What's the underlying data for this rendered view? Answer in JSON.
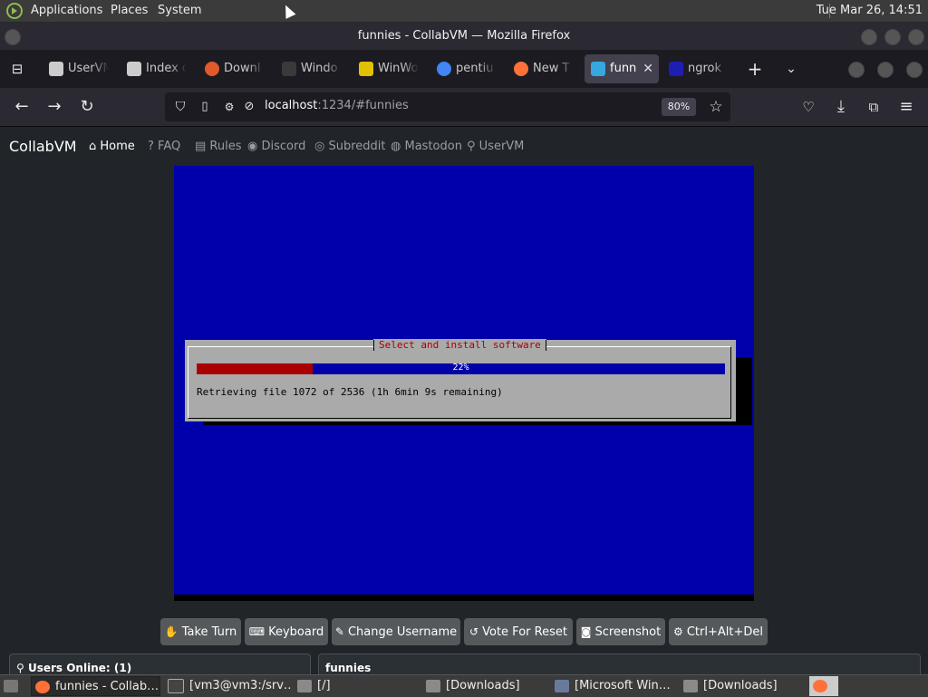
{
  "top_panel": {
    "menus": [
      "Applications",
      "Places",
      "System"
    ],
    "clock": "Tue Mar 26, 14:51"
  },
  "window": {
    "title": "funnies - CollabVM — Mozilla Firefox"
  },
  "tabs": [
    {
      "label": "UserVM",
      "icon": "uservm-icon",
      "color": "#cccccc"
    },
    {
      "label": "Index o",
      "icon": "uservm-icon",
      "color": "#cccccc"
    },
    {
      "label": "Downl",
      "icon": "debian-icon",
      "color": "#e05a2a"
    },
    {
      "label": "Windo",
      "icon": "winworld-icon",
      "color": "#3a3a3a"
    },
    {
      "label": "WinWo",
      "icon": "winworld-w-icon",
      "color": "#e2c100"
    },
    {
      "label": "pentiu",
      "icon": "google-icon",
      "color": "#4285f4"
    },
    {
      "label": "New T",
      "icon": "firefox-icon",
      "color": "#ff7139"
    },
    {
      "label": "funn",
      "icon": "monitor-icon",
      "color": "#37a7e0"
    },
    {
      "label": "ngrok",
      "icon": "ngrok-icon",
      "color": "#1f1eb3"
    }
  ],
  "navbar": {
    "url_host": "localhost",
    "url_rest": ":1234/#funnies",
    "zoom": "80%"
  },
  "site": {
    "brand": "CollabVM",
    "nav": [
      "Home",
      "FAQ",
      "Rules",
      "Discord",
      "Subreddit",
      "Mastodon",
      "UserVM"
    ]
  },
  "vm": {
    "dialog_title": "Select and install software",
    "progress_percent": 22,
    "progress_label": "22%",
    "status": "Retrieving file 1072 of 2536 (1h 6min 9s remaining)"
  },
  "controls": [
    "Take Turn",
    "Keyboard",
    "Change Username",
    "Vote For Reset",
    "Screenshot",
    "Ctrl+Alt+Del"
  ],
  "panels": {
    "users": "Users Online: (1)",
    "chat": "funnies"
  },
  "taskbar": [
    {
      "label": "funnies - Collab…",
      "icon": "firefox-icon",
      "color": "#ff7139"
    },
    {
      "label": "[vm3@vm3:/srv…",
      "icon": "terminal-icon",
      "color": "#444444"
    },
    {
      "label": "[/]",
      "icon": "folder-icon",
      "color": "#8a8a8a"
    },
    {
      "label": "[Downloads]",
      "icon": "folder-icon",
      "color": "#8a8a8a"
    },
    {
      "label": "[Microsoft Win…",
      "icon": "window-icon",
      "color": "#6a7a9a"
    },
    {
      "label": "[Downloads]",
      "icon": "folder-icon",
      "color": "#8a8a8a"
    }
  ]
}
